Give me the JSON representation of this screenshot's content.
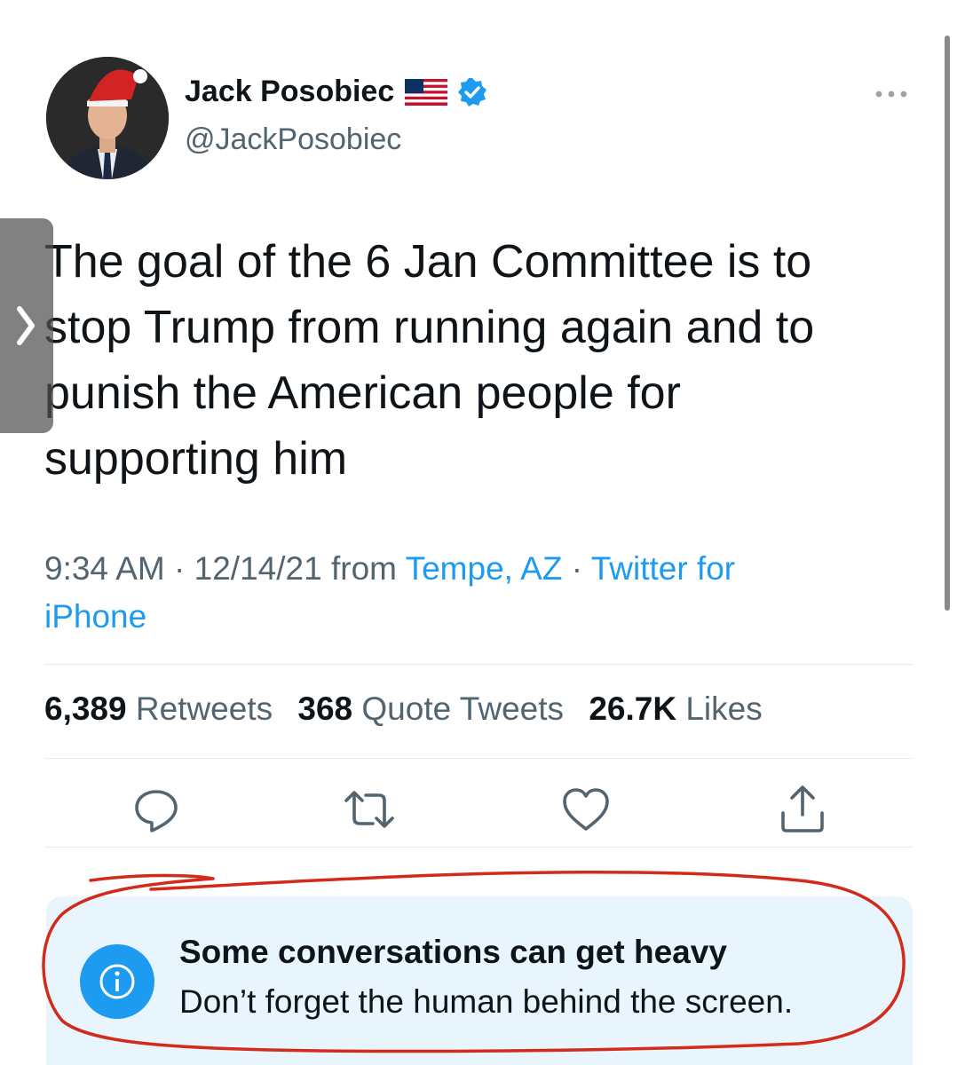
{
  "tweet": {
    "author": {
      "display_name": "Jack Posobiec",
      "handle": "@JackPosobiec",
      "flag_icon": "us-flag-icon",
      "verified_icon": "verified-badge-icon"
    },
    "text_lines": [
      "The goal of the 6 Jan Committee is to",
      "stop Trump from running again and to",
      "punish the American people for",
      "supporting him"
    ],
    "meta": {
      "time": "9:34 AM",
      "date": "12/14/21",
      "from_label": "from",
      "location": "Tempe, AZ",
      "client_line1": "Twitter for",
      "client_line2": "iPhone",
      "separator": "·"
    },
    "stats": {
      "retweets_count": "6,389",
      "retweets_label": "Retweets",
      "quotes_count": "368",
      "quotes_label": "Quote Tweets",
      "likes_count": "26.7K",
      "likes_label": "Likes"
    }
  },
  "notice": {
    "title": "Some conversations can get heavy",
    "body": "Don’t forget the human behind the screen."
  },
  "colors": {
    "accent": "#1d9bf0",
    "text_primary": "#0f1419",
    "text_secondary": "#536471",
    "notice_bg": "#e8f5fd",
    "annotation": "#d22b1b"
  }
}
